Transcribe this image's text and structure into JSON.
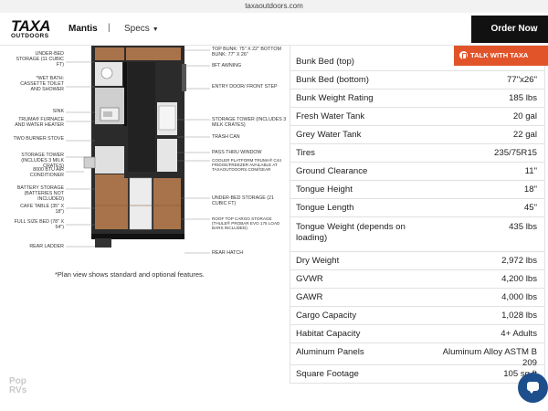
{
  "browser": {
    "url": "taxaoutdoors.com"
  },
  "header": {
    "logo_mark": "TAXA",
    "logo_sub": "OUTDOORS",
    "model": "Mantis",
    "separator": "|",
    "specs_label": "Specs",
    "order_label": "Order Now",
    "accent_color": "#111111"
  },
  "talk_button": {
    "label": "TALK WITH TAXA",
    "color": "#e1542a"
  },
  "floorplan": {
    "labels_left": [
      "UNDER-BED STORAGE (11 CUBIC FT)",
      "*WET BATH: CASSETTE TOILET AND SHOWER",
      "SINK",
      "TRUMA® FURNACE AND WATER HEATER",
      "TWO BURNER STOVE",
      "STORAGE TOWER (INCLUDES 3 MILK CRATES)",
      "8000 BTU AIR CONDITIONER",
      "BATTERY STORAGE (BATTERIES NOT INCLUDED)",
      "CAFE TABLE (35\" X 18\")",
      "FULL SIZE BED (78\" X 54\")",
      "REAR LADDER"
    ],
    "labels_right": [
      "TOP BUNK: 75\" X 22\" BOTTOM BUNK: 77\" X 26\"",
      "8FT AWNING",
      "ENTRY DOOR/ FRONT STEP",
      "STORAGE TOWER (INCLUDES 3 MILK CRATES)",
      "TRASH CAN",
      "PASS THRU WINDOW",
      "COOLER PLATFORM TRUMA® C44 FRIDGE/FREEZER AVAILABLE AT TAXAOUTDOORS.COM/GEAR",
      "UNDER-BED STORAGE (21 CUBIC FT)",
      "ROOF TOP CARGO STORAGE (THULE® PROBAR EVO 175 LOAD BARS INCLUDED)",
      "REAR HATCH"
    ],
    "note": "*Plan view shows standard and optional features.",
    "watermark": "Pop RVs"
  },
  "specs": [
    {
      "label": "Bunk Bed (top)",
      "value": ""
    },
    {
      "label": "Bunk Bed (bottom)",
      "value": "77\"x26\""
    },
    {
      "label": "Bunk Weight Rating",
      "value": "185 lbs"
    },
    {
      "label": "Fresh Water Tank",
      "value": "20 gal"
    },
    {
      "label": "Grey Water Tank",
      "value": "22 gal"
    },
    {
      "label": "Tires",
      "value": "235/75R15"
    },
    {
      "label": "Ground Clearance",
      "value": "11\""
    },
    {
      "label": "Tongue Height",
      "value": "18\""
    },
    {
      "label": "Tongue Length",
      "value": "45\""
    },
    {
      "label": "Tongue Weight (depends on loading)",
      "value": "435 lbs"
    },
    {
      "label": "Dry Weight",
      "value": "2,972 lbs"
    },
    {
      "label": "GVWR",
      "value": "4,200 lbs"
    },
    {
      "label": "GAWR",
      "value": "4,000 lbs"
    },
    {
      "label": "Cargo Capacity",
      "value": "1,028 lbs"
    },
    {
      "label": "Habitat Capacity",
      "value": "4+ Adults"
    },
    {
      "label": "Aluminum Panels",
      "value": "Aluminum Alloy ASTM B 209"
    },
    {
      "label": "Square Footage",
      "value": "105 sq ft"
    }
  ],
  "icons": {
    "order_arrow": "arrow-right-icon",
    "specs_caret": "chevron-down-icon",
    "talk": "phone-icon",
    "chat": "chat-bubble-icon"
  }
}
